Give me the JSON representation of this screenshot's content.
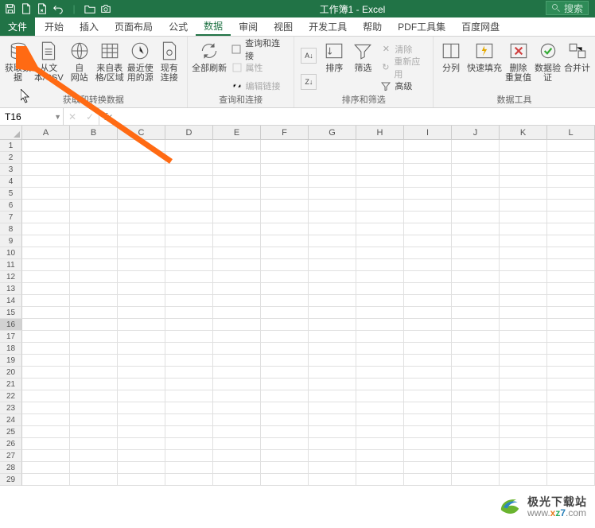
{
  "title": "工作簿1 - Excel",
  "search_placeholder": "搜索",
  "tabs": {
    "file": "文件",
    "home": "开始",
    "insert": "插入",
    "layout": "页面布局",
    "formula": "公式",
    "data": "数据",
    "review": "审阅",
    "view": "视图",
    "dev": "开发工具",
    "help": "帮助",
    "pdf": "PDF工具集",
    "baidu": "百度网盘"
  },
  "ribbon": {
    "get_transform": {
      "get_data": "获取数\n据",
      "from_csv": "从文\n本/CSV",
      "from_web": "自\n网站",
      "from_table": "来自表\n格/区域",
      "recent": "最近使\n用的源",
      "existing": "现有\n连接",
      "label": "获取和转换数据"
    },
    "queries": {
      "refresh": "全部刷新",
      "q": "查询和连接",
      "props": "属性",
      "edit": "编辑链接",
      "label": "查询和连接"
    },
    "sort_filter": {
      "sort": "排序",
      "filter": "筛选",
      "clear": "清除",
      "reapply": "重新应用",
      "advanced": "高级",
      "label": "排序和筛选"
    },
    "data_tools": {
      "split": "分列",
      "flash": "快速填充",
      "dedup": "删除\n重复值",
      "validate": "数据验\n证",
      "consolidate": "合并计",
      "label": "数据工具"
    }
  },
  "namebox": "T16",
  "columns": [
    "A",
    "B",
    "C",
    "D",
    "E",
    "F",
    "G",
    "H",
    "I",
    "J",
    "K",
    "L"
  ],
  "rows": [
    "1",
    "2",
    "3",
    "4",
    "5",
    "6",
    "7",
    "8",
    "9",
    "10",
    "11",
    "12",
    "13",
    "14",
    "15",
    "16",
    "17",
    "18",
    "19",
    "20",
    "21",
    "22",
    "23",
    "24",
    "25",
    "26",
    "27",
    "28",
    "29"
  ],
  "active_row": "16",
  "watermark": {
    "cn": "极光下载站",
    "w1": "www.",
    "x": "x",
    "z": "z",
    "seven": "7",
    "com": ".com"
  }
}
